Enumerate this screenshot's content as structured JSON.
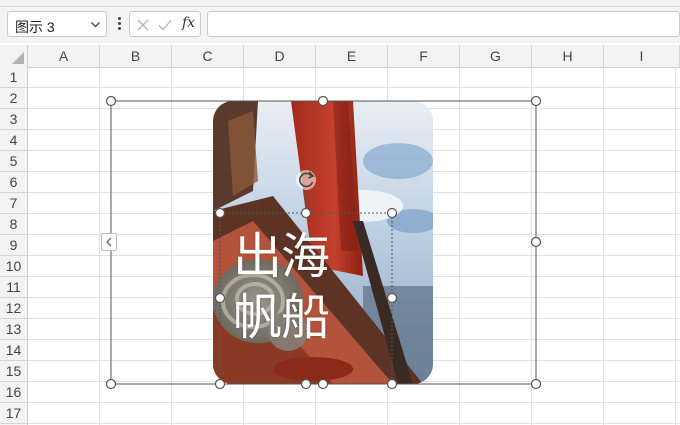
{
  "namebox": {
    "value": "图示 3"
  },
  "formula_bar": {
    "fx_label": "fx",
    "value": ""
  },
  "columns": [
    "A",
    "B",
    "C",
    "D",
    "E",
    "F",
    "G",
    "H",
    "I"
  ],
  "rows": [
    "1",
    "2",
    "3",
    "4",
    "5",
    "6",
    "7",
    "8",
    "9",
    "10",
    "11",
    "12",
    "13",
    "14",
    "15",
    "16",
    "17"
  ],
  "graphic": {
    "text_lines": [
      "出海",
      "帆船"
    ],
    "picture_subject": "sailboat sail and coiled rope photo",
    "text_color": "#ffffff"
  },
  "colors": {
    "chrome_bg": "#f3f3f3",
    "gridline": "#e1e1e1",
    "selection_border": "#555555"
  },
  "icons": [
    "chevron-down-icon",
    "more-vertical-icon",
    "cancel-icon",
    "confirm-icon",
    "function-icon",
    "rotate-icon",
    "collapse-left-icon",
    "select-all-triangle-icon"
  ]
}
